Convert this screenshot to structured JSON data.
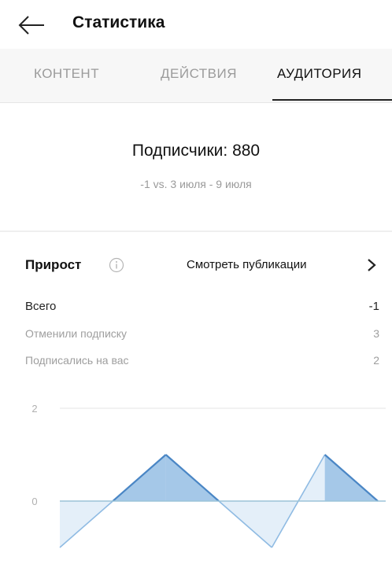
{
  "header": {
    "title": "Статистика",
    "back_icon": "arrow-left-icon"
  },
  "tabs": [
    {
      "label": "КОНТЕНТ",
      "active": false
    },
    {
      "label": "ДЕЙСТВИЯ",
      "active": false
    },
    {
      "label": "АУДИТОРИЯ",
      "active": true
    }
  ],
  "summary": {
    "title": "Подписчики: 880",
    "subtitle": "-1 vs. 3 июля - 9 июля"
  },
  "growth": {
    "title": "Прирост",
    "info_icon": "info-icon",
    "see_posts": "Смотреть публикации",
    "chevron_icon": "chevron-right-icon",
    "rows": [
      {
        "label": "Всего",
        "value": "-1"
      },
      {
        "label": "Отменили подписку",
        "value": "3"
      },
      {
        "label": "Подписались на вас",
        "value": "2"
      }
    ]
  },
  "chart_data": {
    "type": "area",
    "y_ticks": [
      "2",
      "0"
    ],
    "ylim": [
      -1.25,
      2
    ],
    "grid": true,
    "x": [
      0,
      1,
      2,
      3,
      4,
      5,
      6
    ],
    "series": [
      {
        "values": [
          -1,
          0,
          1,
          0,
          -1,
          1,
          0
        ],
        "positive_color": "#5b9bd5",
        "negative_color": "#9fc5e8"
      }
    ]
  }
}
